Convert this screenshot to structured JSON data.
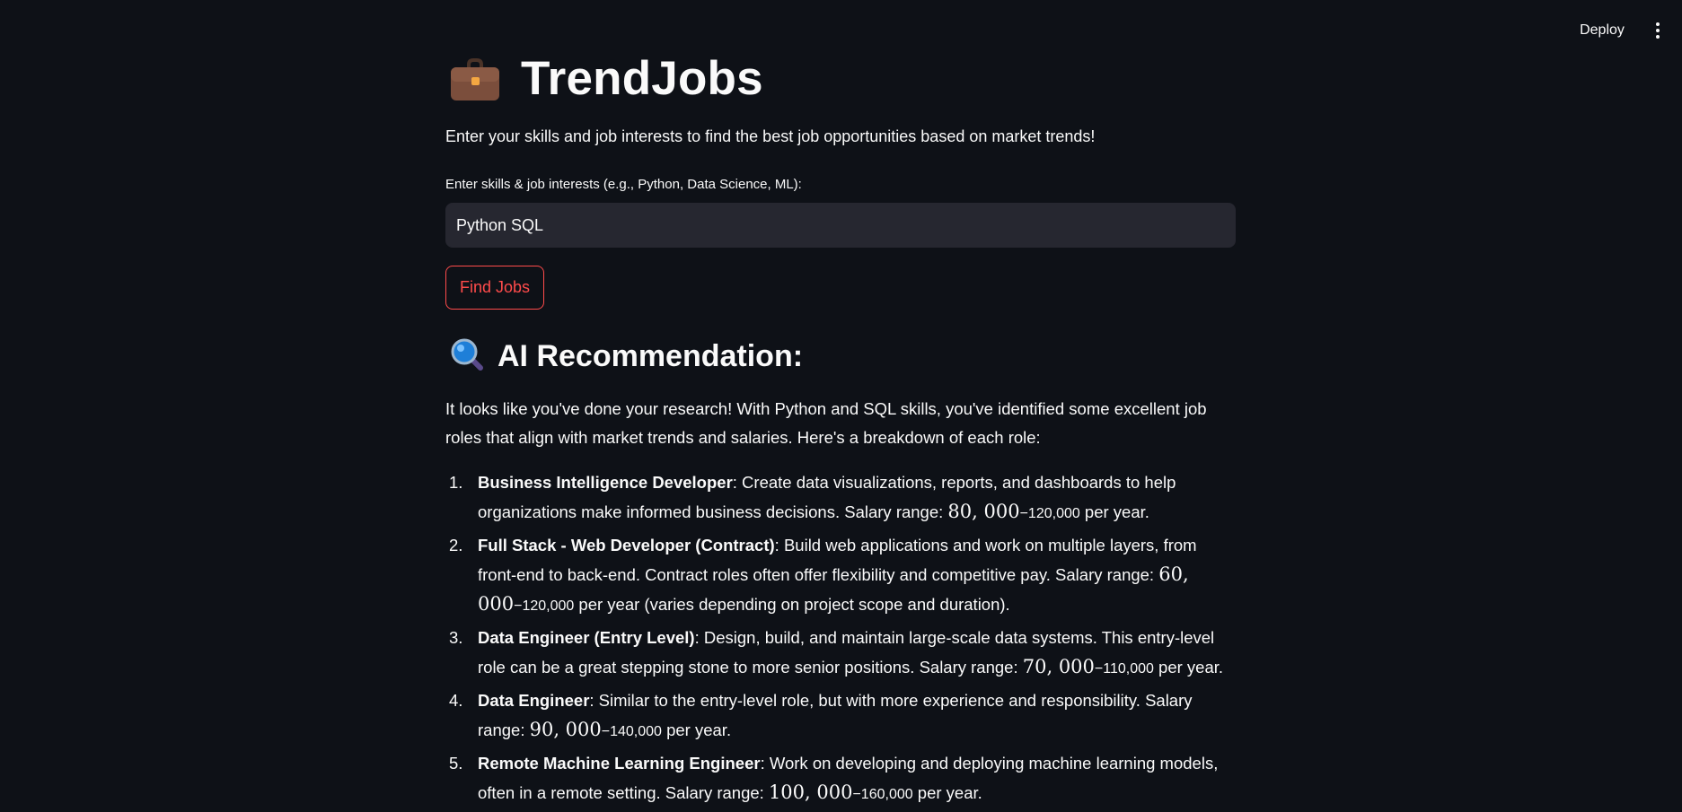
{
  "header": {
    "deploy_label": "Deploy",
    "menu_icon": "more-vertical-icon"
  },
  "app": {
    "title_icon": "briefcase-icon",
    "title": "TrendJobs",
    "subtitle": "Enter your skills and job interests to find the best job opportunities based on market trends!"
  },
  "form": {
    "input_label": "Enter skills & job interests (e.g., Python, Data Science, ML):",
    "input_value": "Python SQL",
    "button_label": "Find Jobs"
  },
  "recommendation": {
    "heading_icon": "magnifying-glass-icon",
    "heading": "AI Recommendation:",
    "intro": "It looks like you've done your research! With Python and SQL skills, you've identified some excellent job roles that align with market trends and salaries. Here's a breakdown of each role:",
    "roles": [
      {
        "number": "1.",
        "name": "Business Intelligence Developer",
        "desc": ": Create data visualizations, reports, and dashboards to help organizations make informed business decisions. Salary range: ",
        "salary_low": "80, 000",
        "salary_high": "−120,000",
        "suffix": " per year."
      },
      {
        "number": "2.",
        "name": "Full Stack - Web Developer (Contract)",
        "desc": ": Build web applications and work on multiple layers, from front-end to back-end. Contract roles often offer flexibility and competitive pay. Salary range: ",
        "salary_low": "60, 000",
        "salary_high": "−120,000",
        "suffix": " per year (varies depending on project scope and duration)."
      },
      {
        "number": "3.",
        "name": "Data Engineer (Entry Level)",
        "desc": ": Design, build, and maintain large-scale data systems. This entry-level role can be a great stepping stone to more senior positions. Salary range: ",
        "salary_low": "70, 000",
        "salary_high": "−110,000",
        "suffix": " per year."
      },
      {
        "number": "4.",
        "name": "Data Engineer",
        "desc": ": Similar to the entry-level role, but with more experience and responsibility. Salary range: ",
        "salary_low": "90, 000",
        "salary_high": "−140,000",
        "suffix": " per year."
      },
      {
        "number": "5.",
        "name": "Remote Machine Learning Engineer",
        "desc": ": Work on developing and deploying machine learning models, often in a remote setting. Salary range: ",
        "salary_low": "100, 000",
        "salary_high": "−160,000",
        "suffix": " per year."
      }
    ]
  },
  "colors": {
    "background": "#0e1117",
    "input_bg": "#262730",
    "accent": "#ff4b4b",
    "text": "#fafafa"
  }
}
